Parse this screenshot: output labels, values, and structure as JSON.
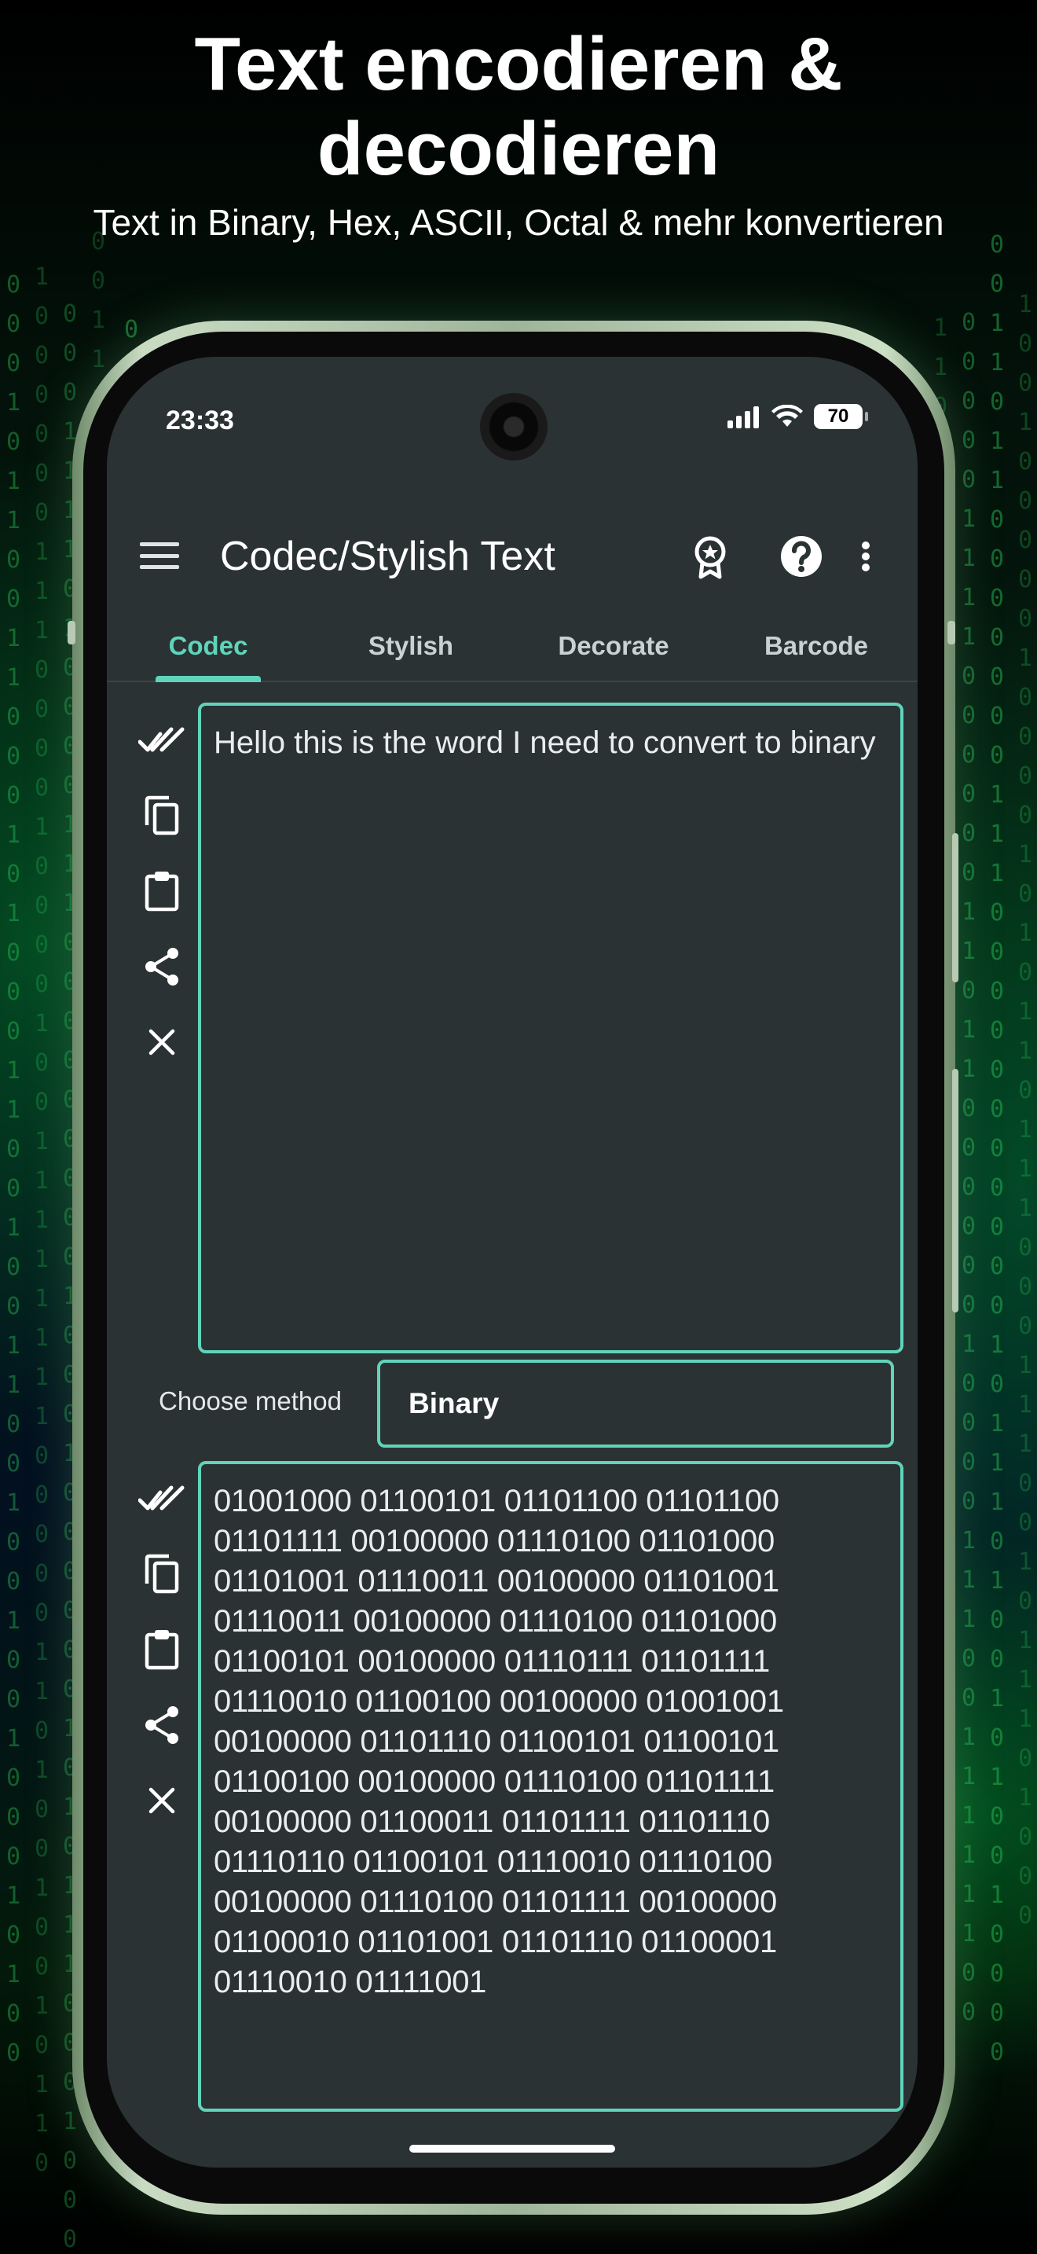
{
  "promo": {
    "headline": "Text encodieren & decodieren",
    "subline": "Text in Binary, Hex, ASCII, Octal & mehr konvertieren"
  },
  "status_bar": {
    "time": "23:33",
    "battery": "70",
    "icons": [
      "signal-icon",
      "wifi-icon",
      "battery-icon"
    ]
  },
  "app_bar": {
    "title": "Codec/Stylish Text",
    "icons": [
      "menu-icon",
      "award-icon",
      "help-icon",
      "more-vert-icon"
    ]
  },
  "tabs": [
    {
      "label": "Codec",
      "active": true
    },
    {
      "label": "Stylish",
      "active": false
    },
    {
      "label": "Decorate",
      "active": false
    },
    {
      "label": "Barcode",
      "active": false
    }
  ],
  "input": {
    "text": "Hello this is the word I need to convert to binary"
  },
  "tool_icons": [
    "select-all-icon",
    "copy-icon",
    "paste-icon",
    "share-icon",
    "clear-icon"
  ],
  "method": {
    "label": "Choose method",
    "value": "Binary"
  },
  "output": {
    "text": "01001000 01100101 01101100 01101100 01101111 00100000 01110100 01101000 01101001 01110011 00100000 01101001 01110011 00100000 01110100 01101000 01100101 00100000 01110111 01101111 01110010 01100100 00100000 01001001 00100000 01101110 01100101 01100101 01100100 00100000 01110100 01101111 00100000 01100011 01101111 01101110 01110110 01100101 01110010 01110100 00100000 01110100 01101111 00100000 01100010 01101001 01101110 01100001 01110010 01111001"
  },
  "colors": {
    "accent": "#5fd4bb",
    "screen_bg": "#2b3233",
    "text": "#e8eeee"
  }
}
